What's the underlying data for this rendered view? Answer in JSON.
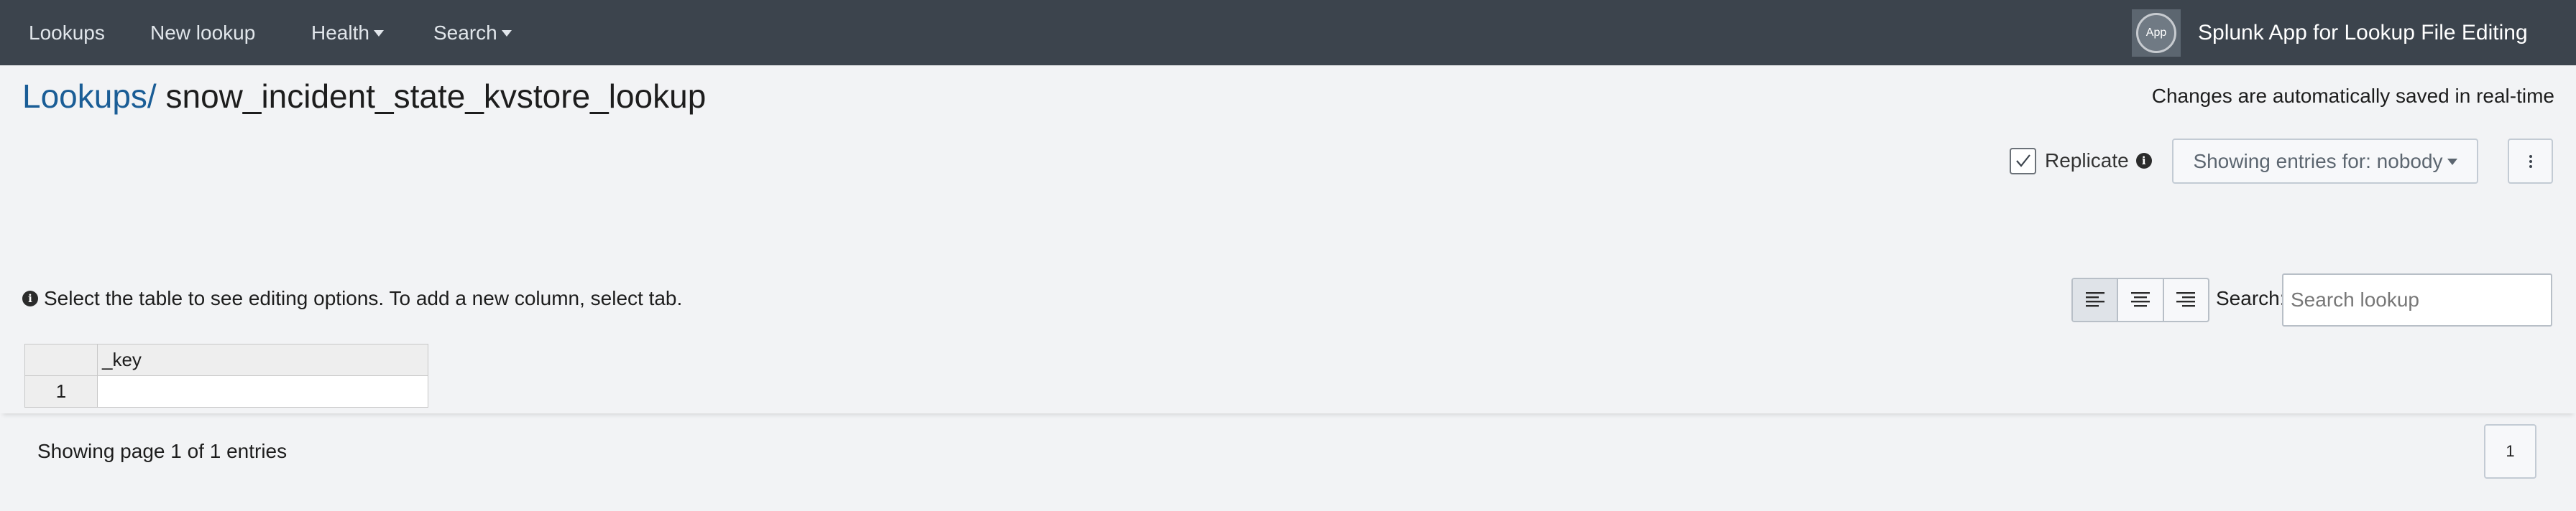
{
  "nav": {
    "items": [
      {
        "label": "Lookups",
        "has_dropdown": false
      },
      {
        "label": "New lookup",
        "has_dropdown": false
      },
      {
        "label": "Health",
        "has_dropdown": true
      },
      {
        "label": "Search",
        "has_dropdown": true
      }
    ],
    "app_badge": "App",
    "app_title": "Splunk App for Lookup File Editing"
  },
  "header": {
    "breadcrumb_link": "Lookups/",
    "lookup_name": "snow_incident_state_kvstore_lookup",
    "autosave_note": "Changes are automatically saved in real-time"
  },
  "controls": {
    "replicate_label": "Replicate",
    "replicate_checked": true,
    "info_icon": "i",
    "entries_button": "Showing entries for: nobody"
  },
  "table_tools": {
    "help_text": "Select the table to see editing options. To add a new column, select tab.",
    "alignment_options": [
      "align-left",
      "align-center",
      "align-right"
    ],
    "active_alignment": "align-left",
    "search_label": "Search:",
    "search_placeholder": "Search lookup",
    "search_value": ""
  },
  "table": {
    "columns": [
      "_key"
    ],
    "rows": [
      {
        "row_number": "1",
        "cells": [
          ""
        ]
      }
    ]
  },
  "footer": {
    "summary": "Showing page 1 of 1 entries",
    "current_page": "1"
  },
  "colors": {
    "navbar": "#3c444d",
    "link": "#1a5d96",
    "background": "#f2f3f5"
  }
}
